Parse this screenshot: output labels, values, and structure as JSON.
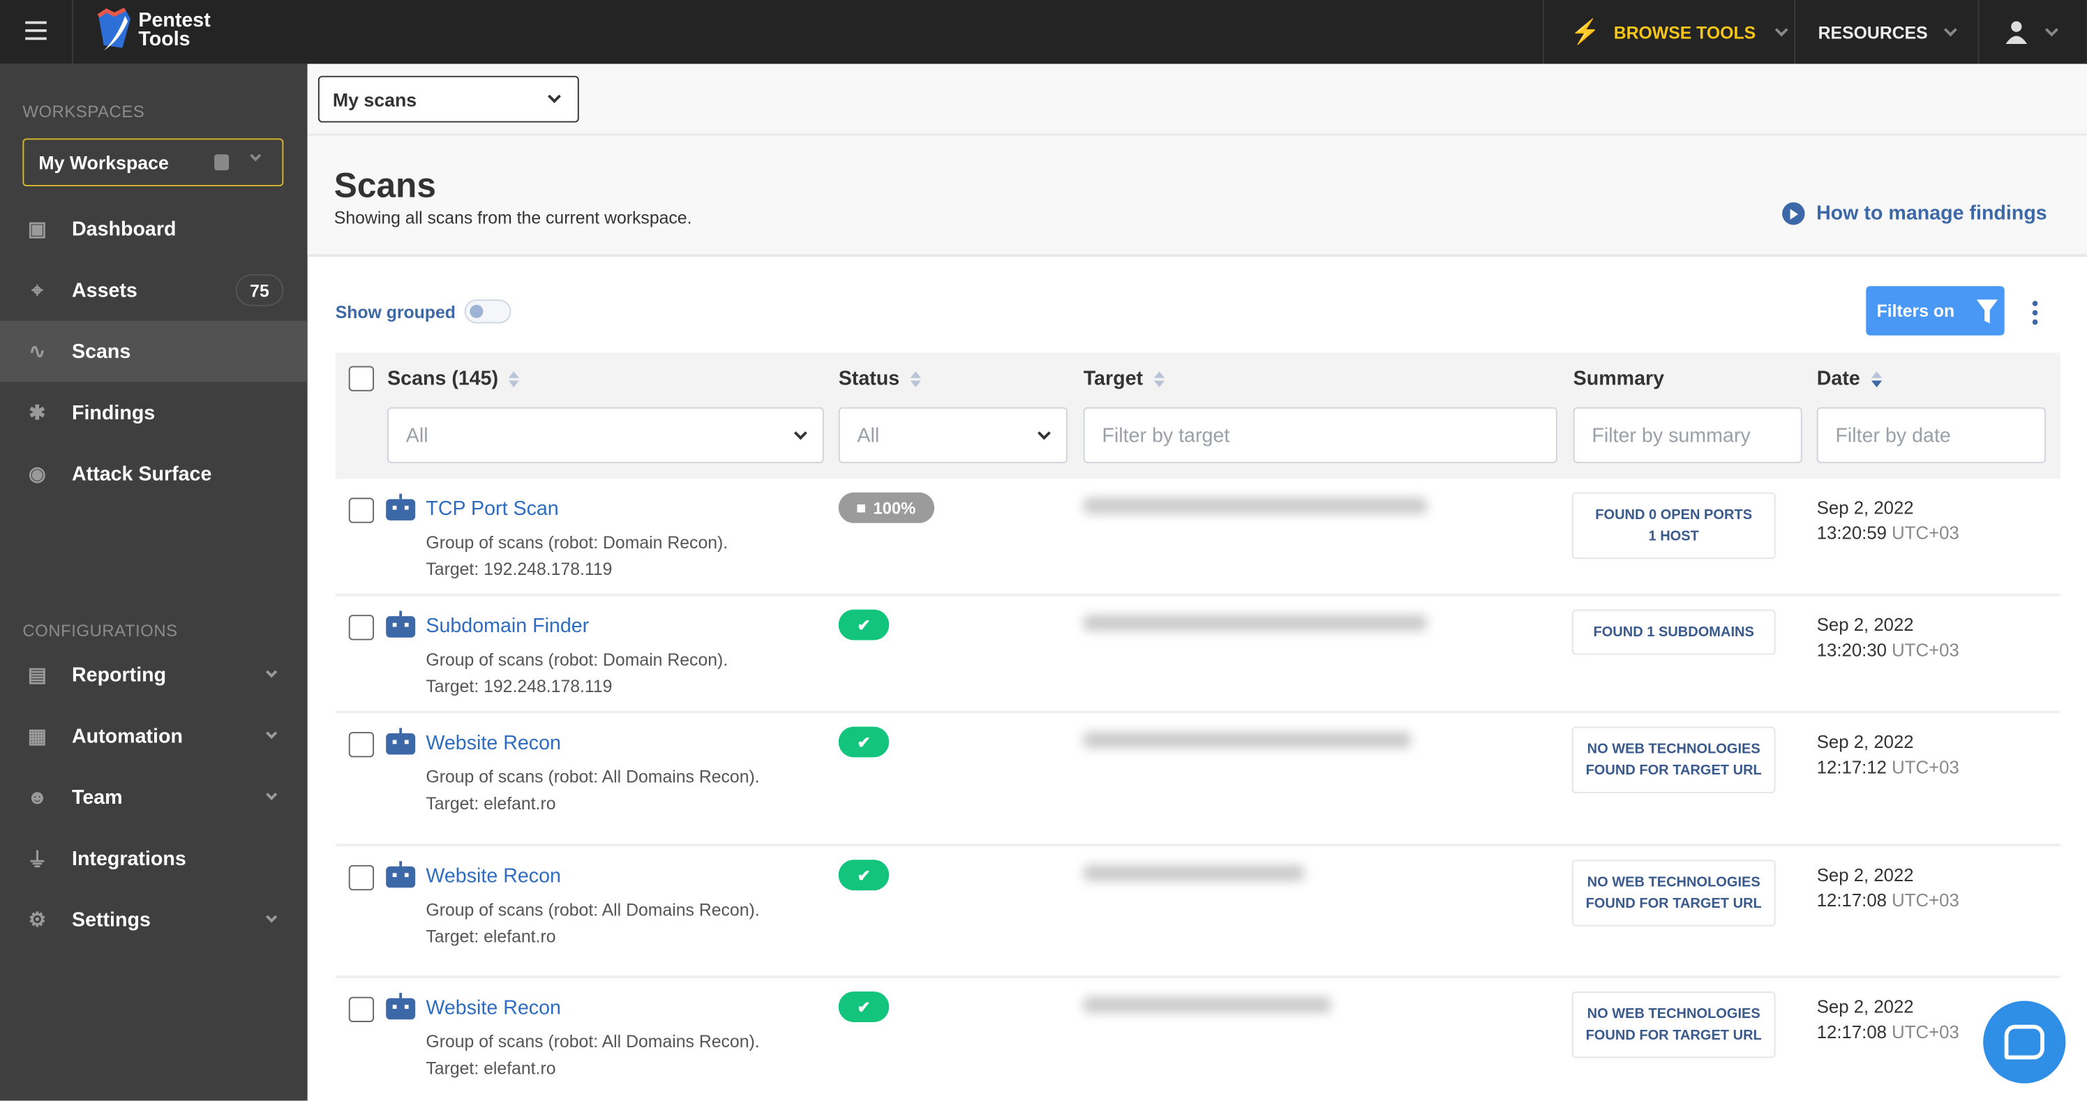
{
  "topbar": {
    "brand": "Pentest Tools",
    "browse_tools": "BROWSE TOOLS",
    "resources": "RESOURCES",
    "accent_color": "#f5c518"
  },
  "sidebar": {
    "workspaces_label": "WORKSPACES",
    "workspace": "My Workspace",
    "items": [
      {
        "label": "Dashboard",
        "icon": "dashboard-icon"
      },
      {
        "label": "Assets",
        "icon": "crosshair-icon",
        "badge": "75"
      },
      {
        "label": "Scans",
        "icon": "pulse-icon",
        "active": true
      },
      {
        "label": "Findings",
        "icon": "bug-icon"
      },
      {
        "label": "Attack Surface",
        "icon": "compass-icon"
      }
    ],
    "configurations_label": "CONFIGURATIONS",
    "config_items": [
      {
        "label": "Reporting",
        "icon": "clipboard-icon"
      },
      {
        "label": "Automation",
        "icon": "robot-icon"
      },
      {
        "label": "Team",
        "icon": "team-icon"
      },
      {
        "label": "Integrations",
        "icon": "plug-icon"
      },
      {
        "label": "Settings",
        "icon": "gear-icon"
      }
    ]
  },
  "main": {
    "scope_select": "My scans",
    "title": "Scans",
    "subtitle": "Showing all scans from the current workspace.",
    "help_link": "How to manage findings",
    "show_grouped": "Show grouped",
    "show_grouped_on": false,
    "filters_button": "Filters on"
  },
  "table": {
    "headers": {
      "scans": "Scans (145)",
      "status": "Status",
      "target": "Target",
      "summary": "Summary",
      "date": "Date"
    },
    "filters": {
      "scans": "All",
      "status": "All",
      "target_placeholder": "Filter by target",
      "summary_placeholder": "Filter by summary",
      "date_placeholder": "Filter by date"
    },
    "rows": [
      {
        "name": "TCP Port Scan",
        "group": "Group of scans (robot: Domain Recon).",
        "target": "Target: 192.248.178.119",
        "status": "running",
        "progress": "100%",
        "summary": "FOUND 0 OPEN PORTS 1 HOST",
        "date": "Sep 2, 2022",
        "time": "13:20:59",
        "tz": "UTC+03"
      },
      {
        "name": "Subdomain Finder",
        "group": "Group of scans (robot: Domain Recon).",
        "target": "Target: 192.248.178.119",
        "status": "finished",
        "summary": "FOUND 1 SUBDOMAINS",
        "date": "Sep 2, 2022",
        "time": "13:20:30",
        "tz": "UTC+03"
      },
      {
        "name": "Website Recon",
        "group": "Group of scans (robot: All Domains Recon).",
        "target": "Target: elefant.ro",
        "status": "finished",
        "summary": "NO WEB TECHNOLOGIES FOUND FOR TARGET URL",
        "date": "Sep 2, 2022",
        "time": "12:17:12",
        "tz": "UTC+03"
      },
      {
        "name": "Website Recon",
        "group": "Group of scans (robot: All Domains Recon).",
        "target": "Target: elefant.ro",
        "status": "finished",
        "summary": "NO WEB TECHNOLOGIES FOUND FOR TARGET URL",
        "date": "Sep 2, 2022",
        "time": "12:17:08",
        "tz": "UTC+03"
      },
      {
        "name": "Website Recon",
        "group": "Group of scans (robot: All Domains Recon).",
        "target": "Target: elefant.ro",
        "status": "finished",
        "summary": "NO WEB TECHNOLOGIES FOUND FOR TARGET URL",
        "date": "Sep 2, 2022",
        "time": "12:17:08",
        "tz": "UTC+03"
      }
    ]
  }
}
